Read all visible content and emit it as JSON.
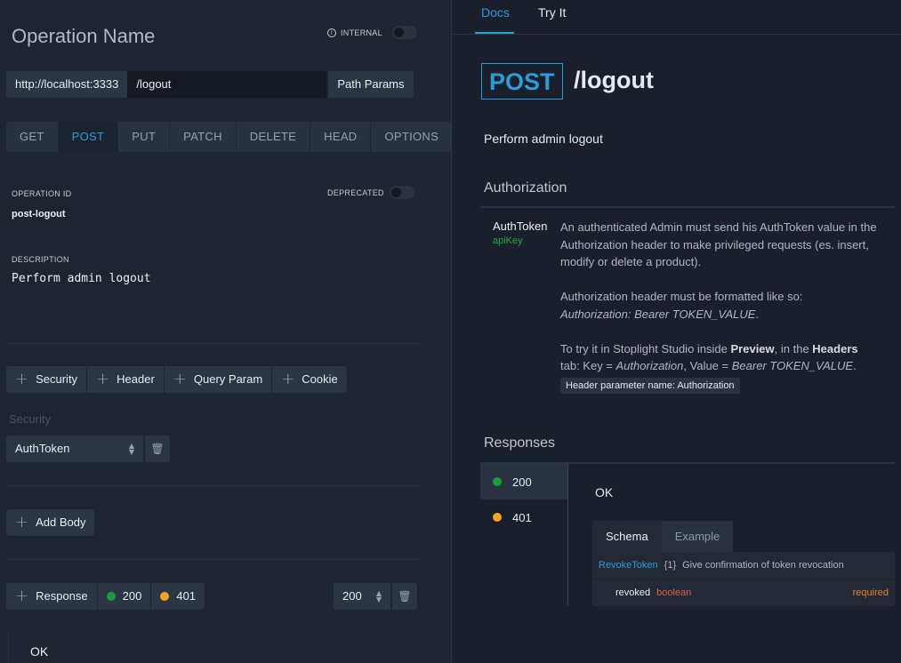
{
  "left": {
    "title": "Operation Name",
    "internal_label": "INTERNAL",
    "host": "http://localhost:3333",
    "path": "/logout",
    "path_params_label": "Path Params",
    "methods": [
      "GET",
      "POST",
      "PUT",
      "PATCH",
      "DELETE",
      "HEAD",
      "OPTIONS"
    ],
    "active_method": "POST",
    "operation_id_label": "OPERATION ID",
    "operation_id": "post-logout",
    "deprecated_label": "DEPRECATED",
    "description_label": "DESCRIPTION",
    "description": "Perform admin logout",
    "add_buttons": {
      "security": "Security",
      "header": "Header",
      "query": "Query Param",
      "cookie": "Cookie"
    },
    "security_label": "Security",
    "security_value": "AuthToken",
    "add_body_label": "Add Body",
    "response_label": "Response",
    "response_codes": [
      "200",
      "401"
    ],
    "response_select": "200",
    "response_desc": "OK"
  },
  "right": {
    "tabs": [
      "Docs",
      "Try It"
    ],
    "active_tab": "Docs",
    "method": "POST",
    "path": "/logout",
    "description": "Perform admin logout",
    "authorization_heading": "Authorization",
    "auth_name": "AuthToken",
    "auth_type": "apiKey",
    "auth_p1": "An authenticated Admin must send his AuthToken value in the Authorization header to make privileged requests (es. insert, modify or delete a product).",
    "auth_p2a": "Authorization header must be formatted like so:",
    "auth_p2b": "Authorization: Bearer TOKEN_VALUE",
    "auth_p3_1": "To try it in Stoplight Studio inside ",
    "auth_p3_2": "Preview",
    "auth_p3_3": ", in the ",
    "auth_p3_4": "Headers",
    "auth_p3_5": " tab: Key = ",
    "auth_p3_6": "Authorization",
    "auth_p3_7": ", Value = ",
    "auth_p3_8": "Bearer TOKEN_VALUE",
    "header_param": "Header parameter name: Authorization",
    "responses_heading": "Responses",
    "responses": [
      "200",
      "401"
    ],
    "ok": "OK",
    "schema_tab": "Schema",
    "example_tab": "Example",
    "schema_name": "RevokeToken",
    "schema_count": "{1}",
    "schema_desc": "Give confirmation of token revocation",
    "prop_name": "revoked",
    "prop_type": "boolean",
    "prop_required": "required"
  },
  "colors": {
    "accent": "#2d9cdb",
    "success": "#1a9c3f",
    "warning": "#f5a623"
  }
}
